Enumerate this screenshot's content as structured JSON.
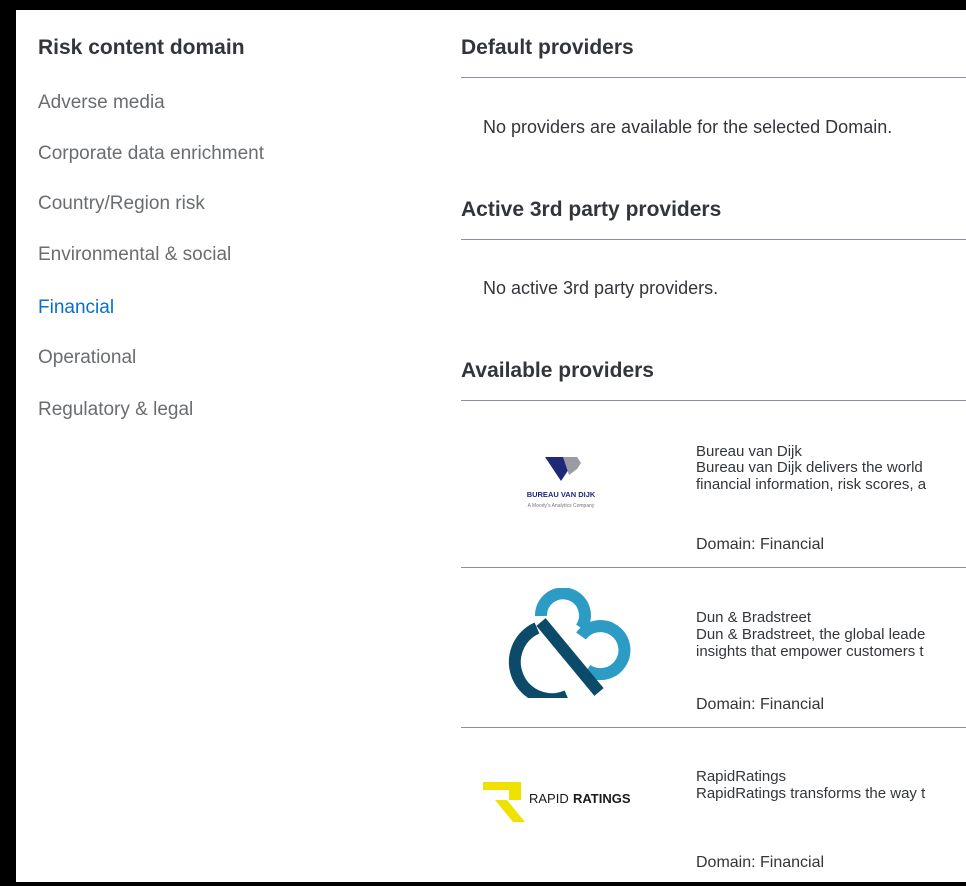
{
  "nav": {
    "title": "Risk content domain",
    "items": [
      {
        "label": "Adverse media",
        "active": false
      },
      {
        "label": "Corporate data enrichment",
        "active": false
      },
      {
        "label": "Country/Region risk",
        "active": false
      },
      {
        "label": "Environmental & social",
        "active": false
      },
      {
        "label": "Financial",
        "active": true
      },
      {
        "label": "Operational",
        "active": false
      },
      {
        "label": "Regulatory & legal",
        "active": false
      }
    ]
  },
  "default_providers": {
    "title": "Default providers",
    "message": "No providers are available for the selected Domain."
  },
  "active_providers": {
    "title": "Active 3rd party providers",
    "message": "No active 3rd party providers."
  },
  "available_providers": {
    "title": "Available providers",
    "items": [
      {
        "name": "Bureau van Dijk",
        "desc_line1": "Bureau van Dijk delivers the world",
        "desc_line2": "financial information, risk scores, a",
        "domain": "Domain: Financial",
        "logo_text": "BUREAU VAN DIJK",
        "logo_subtext": "A Moody's Analytics Company"
      },
      {
        "name": "Dun & Bradstreet",
        "desc_line1": "Dun & Bradstreet, the global leade",
        "desc_line2": "insights that empower customers t",
        "domain": "Domain: Financial"
      },
      {
        "name": "RapidRatings",
        "desc_line1": "RapidRatings transforms the way t",
        "domain": "Domain: Financial",
        "logo_text_light": "RAPID",
        "logo_text_bold": "RATINGS"
      }
    ]
  },
  "colors": {
    "accent": "#0a6ed1",
    "bvd_navy": "#1e2a78",
    "bvd_gray": "#9a9ca3",
    "dnb_blue": "#2d9cc4",
    "dnb_dark": "#0b4a68",
    "rr_yellow": "#f0e200"
  }
}
